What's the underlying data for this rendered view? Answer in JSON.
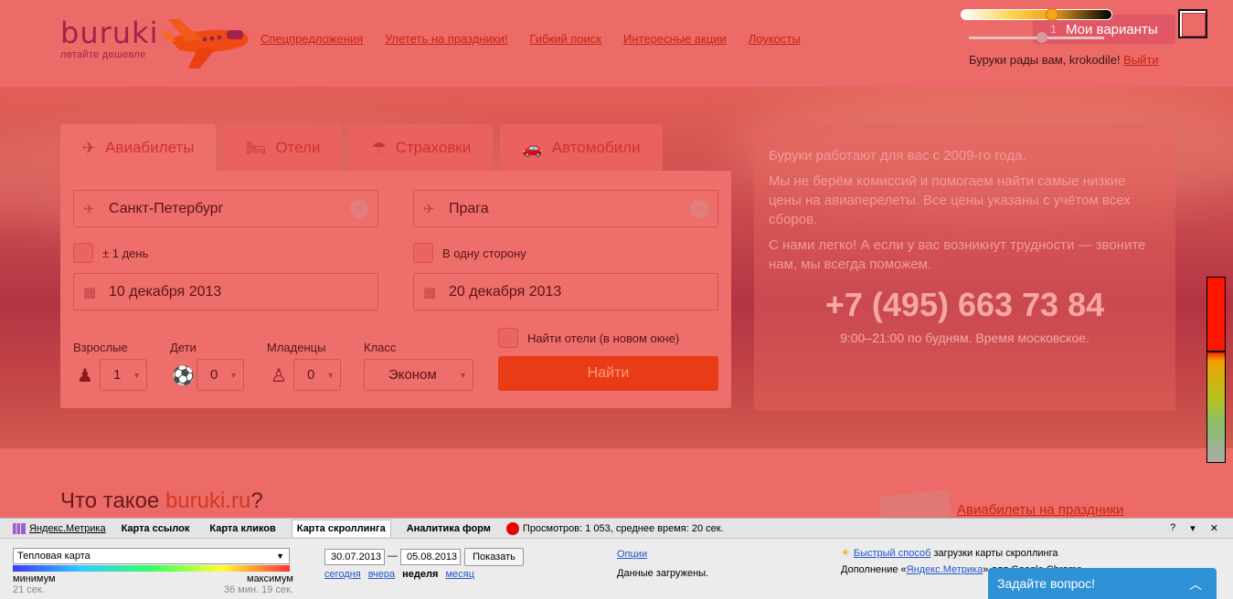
{
  "header": {
    "logo_word": "buruki",
    "logo_tagline": "летайте дешевле",
    "nav": [
      "Спецпредложения",
      "Улететь на праздники!",
      "Гибкий поиск",
      "Интересные акции",
      "Лоукосты"
    ],
    "my_variants_label": "Мои варианты",
    "my_variants_count": "1",
    "welcome_text": "Буруки рады вам, krokodile!",
    "logout_label": "Выйти"
  },
  "search": {
    "tabs": [
      {
        "label": "Авиабилеты",
        "icon": "plane-icon"
      },
      {
        "label": "Отели",
        "icon": "bed-icon"
      },
      {
        "label": "Страховки",
        "icon": "umbrella-icon"
      },
      {
        "label": "Автомобили",
        "icon": "car-icon"
      }
    ],
    "from_value": "Санкт-Петербург",
    "to_value": "Прага",
    "flex_day_label": "± 1 день",
    "one_way_label": "В одну сторону",
    "depart_date": "10 декабря 2013",
    "return_date": "20 декабря 2013",
    "adults_label": "Взрослые",
    "adults_value": "1",
    "children_label": "Дети",
    "children_value": "0",
    "infants_label": "Младенцы",
    "infants_value": "0",
    "class_label": "Класс",
    "class_value": "Эконом",
    "hotels_label": "Найти отели (в новом окне)",
    "find_label": "Найти"
  },
  "info": {
    "line1": "Буруки работают для вас с 2009-го года.",
    "line2": "Мы не берём комиссий и помогаем найти самые низкие цены на авиаперелеты. Все цены указаны с учётом всех сборов.",
    "line3": "С нами легко! А если у вас возникнут трудности — звоните нам, мы всегда поможем.",
    "phone": "+7 (495) 663 73 84",
    "hours": "9:00–21:00 по будням. Время московское."
  },
  "below": {
    "title_prefix": "Что такое ",
    "title_brand": "buruki.ru",
    "title_suffix": "?",
    "holiday_link": "Авиабилеты на праздники"
  },
  "metrika": {
    "logo_label": "Яндекс.Метрика",
    "tabs": [
      "Карта ссылок",
      "Карта кликов",
      "Карта скроллинга",
      "Аналитика форм"
    ],
    "stats": "Просмотров: 1 053, среднее время: 20 сек.",
    "map_type": "Тепловая карта",
    "min_label": "минимум",
    "max_label": "максимум",
    "min_value": "21 сек.",
    "max_value": "36 мин. 19 сек.",
    "date_from": "30.07.2013",
    "date_to": "05.08.2013",
    "show_label": "Показать",
    "period_today": "сегодня",
    "period_yesterday": "вчера",
    "period_week": "неделя",
    "period_month": "месяц",
    "options_label": "Опции",
    "loaded_text": "Данные загружены.",
    "tip_link": "Быстрый способ",
    "tip_text": " загрузки карты скроллинга",
    "tip2_prefix": "Дополнение «",
    "tip2_link": "Яндекс.Метрика",
    "tip2_suffix": "» для Google Chrome",
    "help": "?",
    "collapse": "▾",
    "close": "✕"
  },
  "ask_label": "Задайте вопрос!",
  "colors": {
    "accent": "#e93c16",
    "link": "#c7250e",
    "bg": "#ec6a68"
  }
}
